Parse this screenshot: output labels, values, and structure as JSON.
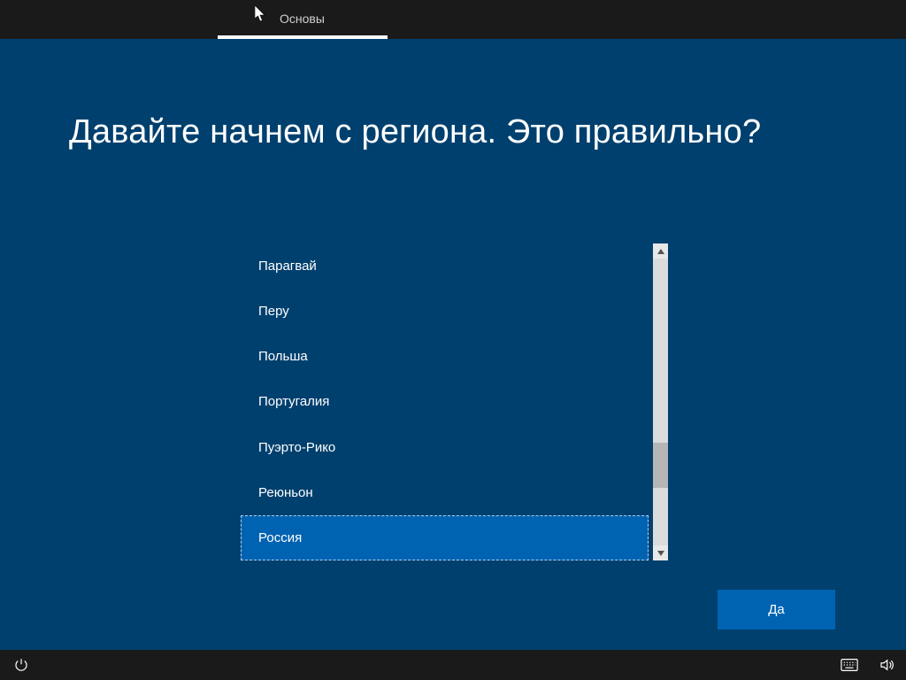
{
  "topbar": {
    "tab_label": "Основы"
  },
  "heading": "Давайте начнем с региона. Это правильно?",
  "region_list": {
    "items": [
      "Парагвай",
      "Перу",
      "Польша",
      "Португалия",
      "Пуэрто-Рико",
      "Реюньон",
      "Россия"
    ],
    "selected_index": 6
  },
  "buttons": {
    "yes": "Да"
  }
}
